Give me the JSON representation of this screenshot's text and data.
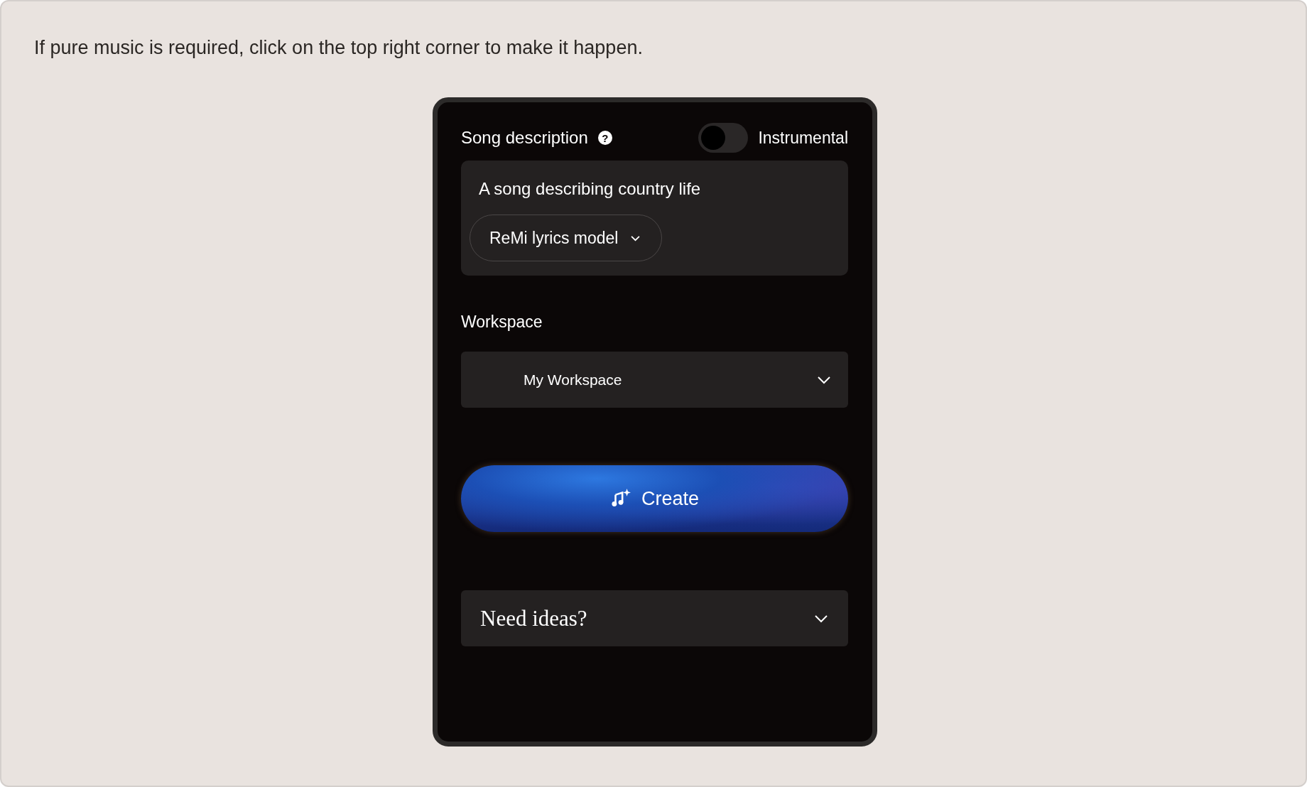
{
  "caption": "If pure music is required, click on the top right corner to make it happen.",
  "song_description": {
    "label": "Song description",
    "help_icon": "?",
    "prompt": "A song describing country life",
    "model": "ReMi lyrics model"
  },
  "instrumental": {
    "label": "Instrumental",
    "on": false
  },
  "workspace": {
    "label": "Workspace",
    "value": "My Workspace"
  },
  "create_button": {
    "label": "Create"
  },
  "need_ideas": {
    "label": "Need ideas?",
    "expanded": false
  }
}
